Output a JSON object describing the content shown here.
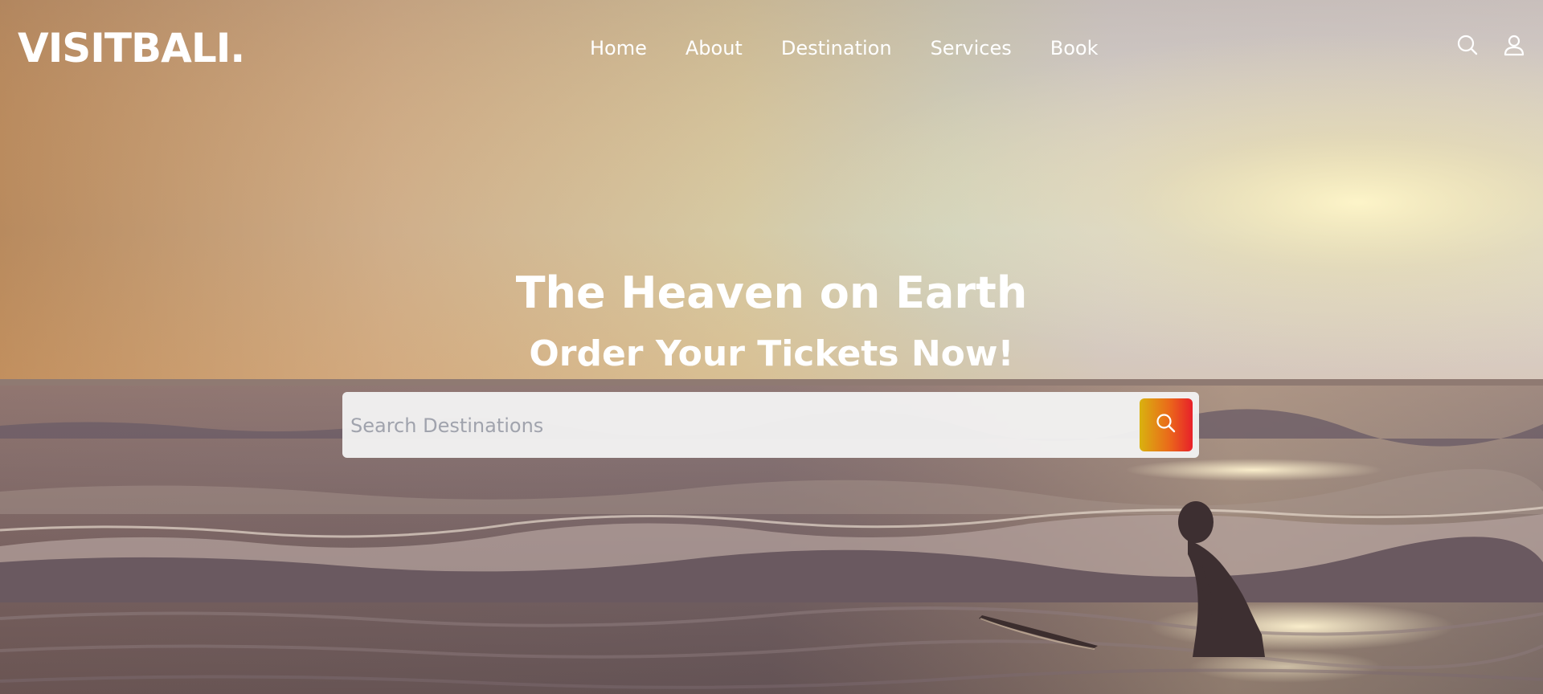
{
  "header": {
    "logo_text": "VISITBALI.",
    "nav_items": [
      {
        "label": "Home"
      },
      {
        "label": "About"
      },
      {
        "label": "Destination"
      },
      {
        "label": "Services"
      },
      {
        "label": "Book"
      }
    ],
    "icons": [
      "search-icon",
      "user-icon"
    ]
  },
  "hero": {
    "title": "The Heaven on Earth",
    "subtitle": "Order Your Tickets Now!",
    "background": "sunset-beach-surfer-photo"
  },
  "search": {
    "placeholder": "Search Destinations",
    "value": "",
    "button_icon": "search-icon"
  },
  "colors": {
    "text": "#ffffff",
    "search_button_gradient_start": "#d9b20f",
    "search_button_gradient_end": "#e8202a",
    "search_bar_bg": "#f3f3f3",
    "placeholder": "#a0a3ad"
  }
}
